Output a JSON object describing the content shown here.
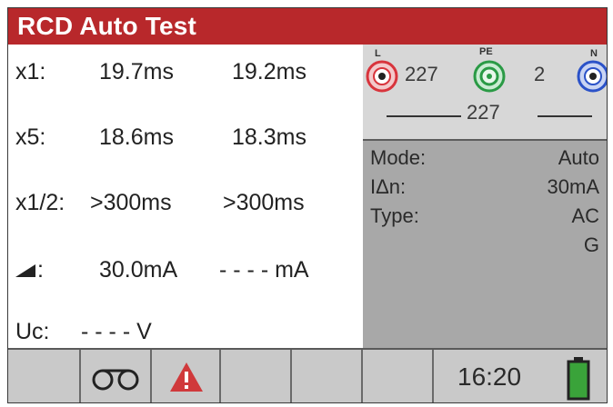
{
  "header": {
    "title": "RCD Auto Test",
    "color": "#b8282b"
  },
  "results": [
    {
      "label": "x1:",
      "v1": "19.7ms",
      "v2": "19.2ms"
    },
    {
      "label": "x5:",
      "v1": "18.6ms",
      "v2": "18.3ms"
    },
    {
      "label": "x1/2:",
      "v1": ">300ms",
      "v2": ">300ms"
    },
    {
      "label_icon": "ramp-icon",
      "label": ":",
      "v1": "30.0mA",
      "v2": "- - - - mA"
    },
    {
      "label": "Uc:",
      "v1": "- - - - V",
      "v2": ""
    }
  ],
  "terminals": {
    "L": {
      "label": "L",
      "color": "#d8343c"
    },
    "PE": {
      "label": "PE",
      "color": "#2a9a45"
    },
    "N": {
      "label": "N",
      "color": "#2b52c8"
    },
    "reading_l_pe": "227",
    "reading_pe_n": "2",
    "reading_l_n": "227"
  },
  "settings": [
    {
      "key": "Mode:",
      "value": "Auto"
    },
    {
      "key": "IΔn:",
      "value": "30mA"
    },
    {
      "key": "Type:",
      "value": "AC"
    },
    {
      "key": "",
      "value": "G"
    }
  ],
  "footer": {
    "time": "16:20",
    "icons": [
      "tape-icon",
      "warning-icon",
      "battery-icon"
    ],
    "warning_color": "#d0393b",
    "battery_color": "#3aa33a"
  }
}
